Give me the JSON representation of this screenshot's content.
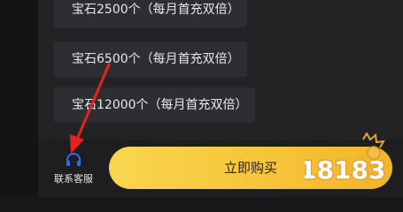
{
  "options": [
    {
      "label": "宝石2500个（每月首充双倍）"
    },
    {
      "label": "宝石6500个（每月首充双倍）"
    },
    {
      "label": "宝石12000个（每月首充双倍）"
    }
  ],
  "footer": {
    "service_label": "联系客服",
    "buy_label": "立即购买"
  },
  "watermark": {
    "text": "18183"
  },
  "colors": {
    "accent": "#f6c53a",
    "arrow": "#e52222",
    "service_icon": "#2f6df5"
  }
}
